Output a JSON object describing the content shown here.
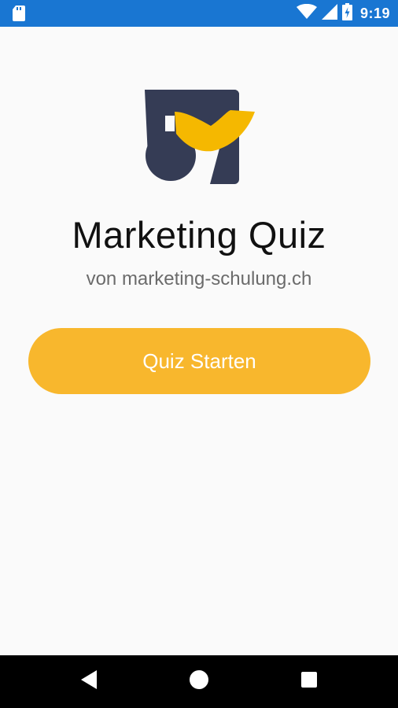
{
  "status_bar": {
    "time": "9:19",
    "icons": [
      "sd-card-icon",
      "wifi-icon",
      "cell-signal-icon",
      "battery-charging-icon"
    ]
  },
  "app": {
    "title": "Marketing Quiz",
    "subtitle": "von marketing-schulung.ch",
    "start_button_label": "Quiz Starten"
  },
  "colors": {
    "status_bar": "#1976d2",
    "background": "#fafafa",
    "accent": "#f8b72d",
    "logo_dark": "#353c55",
    "nav_bar": "#000000"
  },
  "nav_bar": {
    "icons": [
      "back-icon",
      "home-icon",
      "recents-icon"
    ]
  }
}
